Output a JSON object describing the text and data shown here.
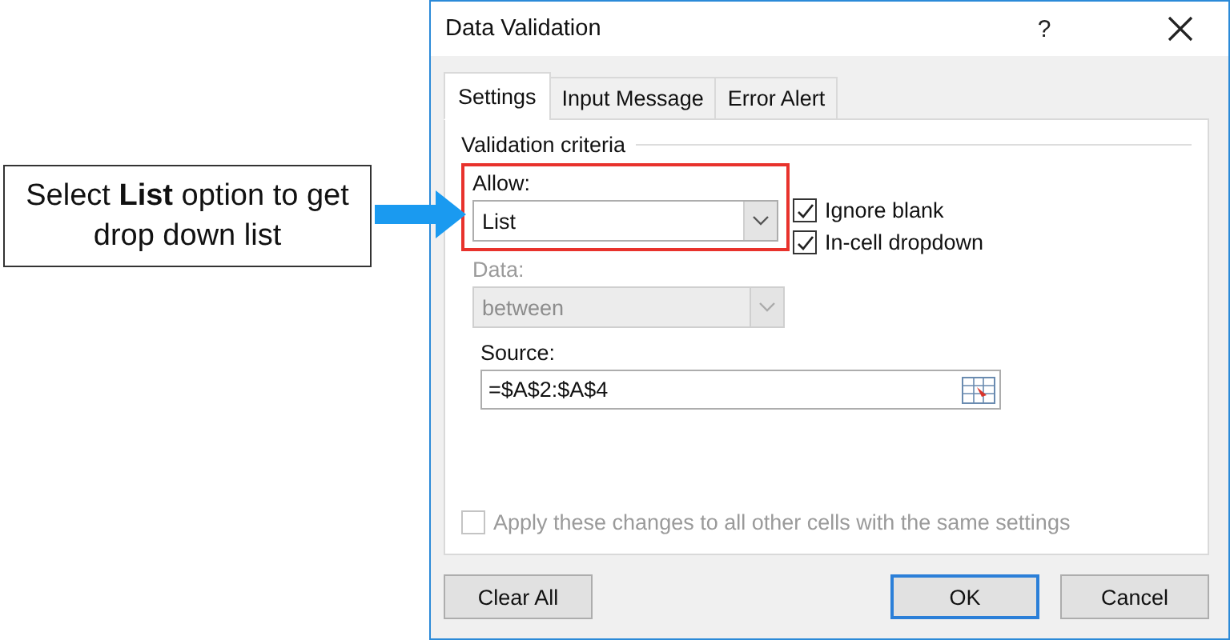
{
  "callout": {
    "text": "Select **List** option to get drop down list"
  },
  "dialog": {
    "title": "Data Validation",
    "help": "?",
    "tabs": [
      {
        "label": "Settings",
        "selected": true
      },
      {
        "label": "Input Message",
        "selected": false
      },
      {
        "label": "Error Alert",
        "selected": false
      }
    ],
    "group_label": "Validation criteria",
    "allow": {
      "label": "Allow:",
      "value": "List",
      "highlighted": true,
      "disabled": false
    },
    "checkboxes": [
      {
        "label": "Ignore blank",
        "checked": true,
        "disabled": false
      },
      {
        "label": "In-cell dropdown",
        "checked": true,
        "disabled": false
      }
    ],
    "data": {
      "label": "Data:",
      "value": "between",
      "disabled": true
    },
    "source": {
      "label": "Source:",
      "value": "=$A$2:$A$4"
    },
    "apply": {
      "label": "Apply these changes to all other cells with the same settings",
      "checked": false,
      "disabled": true
    },
    "buttons": [
      {
        "label": "Clear All",
        "default": false
      },
      {
        "label": "OK",
        "default": true
      },
      {
        "label": "Cancel",
        "default": false
      }
    ]
  }
}
